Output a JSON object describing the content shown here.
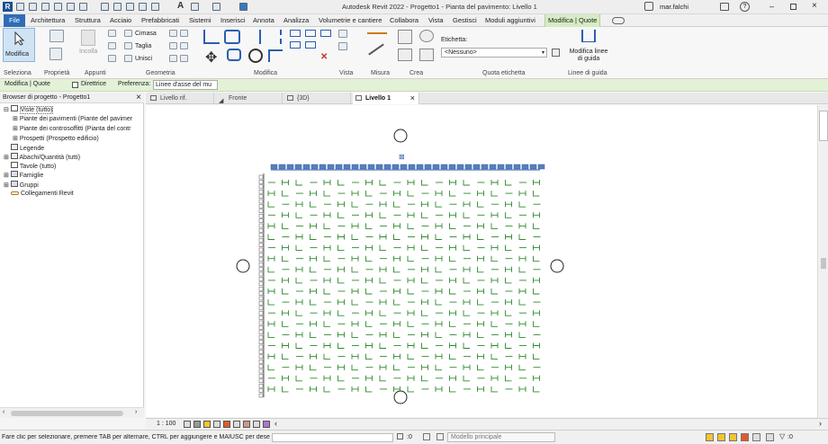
{
  "window": {
    "title": "Autodesk Revit 2022 - Progetto1 - Pianta del pavimento: Livello 1"
  },
  "user": {
    "name": "mar.falchi"
  },
  "tabs": [
    "File",
    "Architettura",
    "Struttura",
    "Acciaio",
    "Prefabbricati",
    "Sistemi",
    "Inserisci",
    "Annota",
    "Analizza",
    "Volumetrie e cantiere",
    "Collabora",
    "Vista",
    "Gestisci",
    "Moduli aggiuntivi",
    "Modifica | Quote"
  ],
  "ribbon": {
    "modifica_label": "Modifica",
    "incolla_label": "Incolla",
    "cimasa_label": "Cimasa",
    "taglia_label": "Taglia",
    "unisci_label": "Unisci",
    "etichetta_label": "Etichetta:",
    "etichetta_value": "<Nessuno>",
    "modifica_linee_label": "Modifica linee di guida",
    "panels": [
      "Seleziona",
      "Proprietà",
      "Appunti",
      "Geometria",
      "Modifica",
      "Vista",
      "Misura",
      "Crea",
      "Quota etichetta",
      "Linee di guida"
    ]
  },
  "options_bar": {
    "context": "Modifica | Quote",
    "direttrice": "Direttrice",
    "preferenza_label": "Preferenza:",
    "preferenza_value": "Linee d'asse del mu"
  },
  "browser": {
    "title": "Browser di progetto - Progetto1",
    "items": [
      "Viste (tutto)",
      "Piante dei pavimenti (Piante del pavimer",
      "Piante dei controsoffitti (Pianta del contr",
      "Prospetti (Prospetto edificio)",
      "Legende",
      "Abachi/Quantità (tutti)",
      "Tavole (tutto)",
      "Famiglie",
      "Gruppi",
      "Collegamenti Revit"
    ]
  },
  "view_tabs": [
    "Livello rif.",
    "Fronte",
    "{3D}",
    "Livello 1"
  ],
  "view_control": {
    "scale": "1 : 100"
  },
  "status": {
    "message": "Fare clic per selezionare, premere TAB per alternare, CTRL per aggiungere e MAIUSC per desel",
    "coord": ":0",
    "model": "Modello principale"
  },
  "colors": {
    "accent_green": "#2e8b2e",
    "file_tab": "#2f6cb8",
    "context_tab": "#d6ecc4",
    "dim_blue": "#2b5fae"
  }
}
